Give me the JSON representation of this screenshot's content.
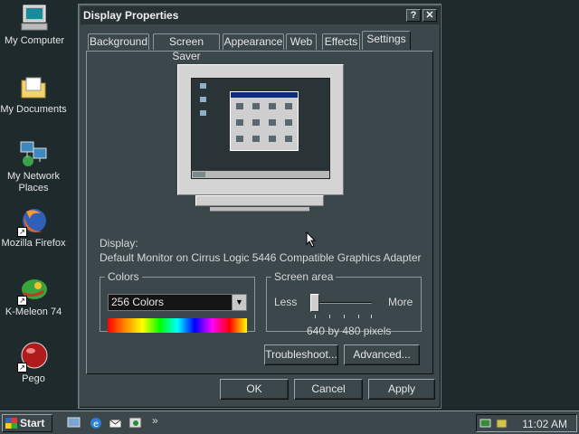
{
  "desktop": {
    "icons": [
      {
        "label": "My Computer",
        "icon": "computer-icon"
      },
      {
        "label": "My Documents",
        "icon": "folder-icon"
      },
      {
        "label": "My Network Places",
        "icon": "network-icon"
      },
      {
        "label": "Mozilla Firefox",
        "icon": "firefox-icon"
      },
      {
        "label": "K-Meleon 74",
        "icon": "kmeleon-icon"
      },
      {
        "label": "Pego",
        "icon": "pego-icon"
      }
    ]
  },
  "window": {
    "title": "Display Properties",
    "help_glyph": "?",
    "close_glyph": "✕",
    "tabs": [
      "Background",
      "Screen Saver",
      "Appearance",
      "Web",
      "Effects",
      "Settings"
    ],
    "active_tab": "Settings",
    "display_label": "Display:",
    "display_value": "Default Monitor on Cirrus Logic 5446 Compatible Graphics Adapter",
    "colors": {
      "legend": "Colors",
      "selected": "256 Colors",
      "arrow": "▼"
    },
    "screen_area": {
      "legend": "Screen area",
      "less_label": "Less",
      "more_label": "More",
      "resolution": "640 by 480 pixels",
      "slider_level": 0
    },
    "buttons": {
      "troubleshoot": "Troubleshoot...",
      "advanced": "Advanced...",
      "ok": "OK",
      "cancel": "Cancel",
      "apply": "Apply"
    }
  },
  "taskbar": {
    "start_label": "Start",
    "overflow": "»",
    "clock": "11:02 AM"
  },
  "colors": {
    "desktop_bg": "#1f2a2c",
    "window_bg": "#3b474a",
    "titlebar_bg": "#283235"
  }
}
